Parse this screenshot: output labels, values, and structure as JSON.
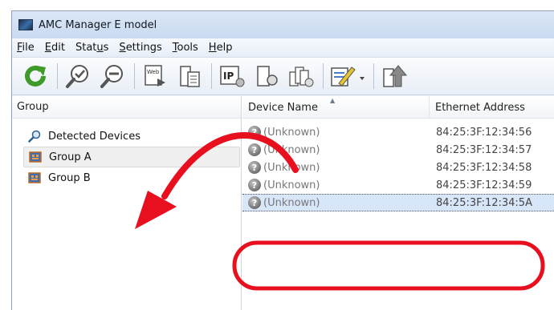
{
  "window": {
    "title": "AMC Manager E model"
  },
  "menu": [
    {
      "id": "file",
      "label": "File",
      "mnemonic": "F",
      "rest": "ile",
      "pre": ""
    },
    {
      "id": "edit",
      "label": "Edit",
      "mnemonic": "E",
      "rest": "dit",
      "pre": ""
    },
    {
      "id": "status",
      "label": "Status",
      "mnemonic": "u",
      "pre": "Stat",
      "rest": "s"
    },
    {
      "id": "settings",
      "label": "Settings",
      "mnemonic": "S",
      "rest": "ettings",
      "pre": ""
    },
    {
      "id": "tools",
      "label": "Tools",
      "mnemonic": "T",
      "rest": "ools",
      "pre": ""
    },
    {
      "id": "help",
      "label": "Help",
      "mnemonic": "H",
      "rest": "elp",
      "pre": ""
    }
  ],
  "toolbar": {
    "web_label": "Web",
    "ip_label": "IP",
    "icons": [
      "refresh-icon",
      "zoom-in-icon",
      "zoom-out-icon",
      "web-icon",
      "device-doc-icon",
      "ip-settings-icon",
      "device-settings-icon",
      "group-settings-icon",
      "edit-icon",
      "upload-icon"
    ]
  },
  "left_pane": {
    "header": "Group",
    "items": [
      {
        "label": "Detected Devices",
        "icon": "search-icon",
        "selected": false
      },
      {
        "label": "Group A",
        "icon": "group-icon",
        "selected": true
      },
      {
        "label": "Group B",
        "icon": "group-icon",
        "selected": false
      }
    ]
  },
  "table": {
    "columns": [
      "Device Name",
      "Ethernet Address"
    ],
    "rows": [
      {
        "name": "(Unknown)",
        "ethernet": "84:25:3F:12:34:56",
        "selected": false
      },
      {
        "name": "(Unknown)",
        "ethernet": "84:25:3F:12:34:57",
        "selected": false
      },
      {
        "name": "(Unknown)",
        "ethernet": "84:25:3F:12:34:58",
        "selected": false
      },
      {
        "name": "(Unknown)",
        "ethernet": "84:25:3F:12:34:59",
        "selected": false
      },
      {
        "name": "(Unknown)",
        "ethernet": "84:25:3F:12:34:5A",
        "selected": true
      }
    ],
    "status_icon": "unknown-status-icon"
  },
  "annotation": {
    "color": "#e8101e",
    "shapes": [
      "drag-arrow",
      "highlight-ellipse"
    ]
  }
}
